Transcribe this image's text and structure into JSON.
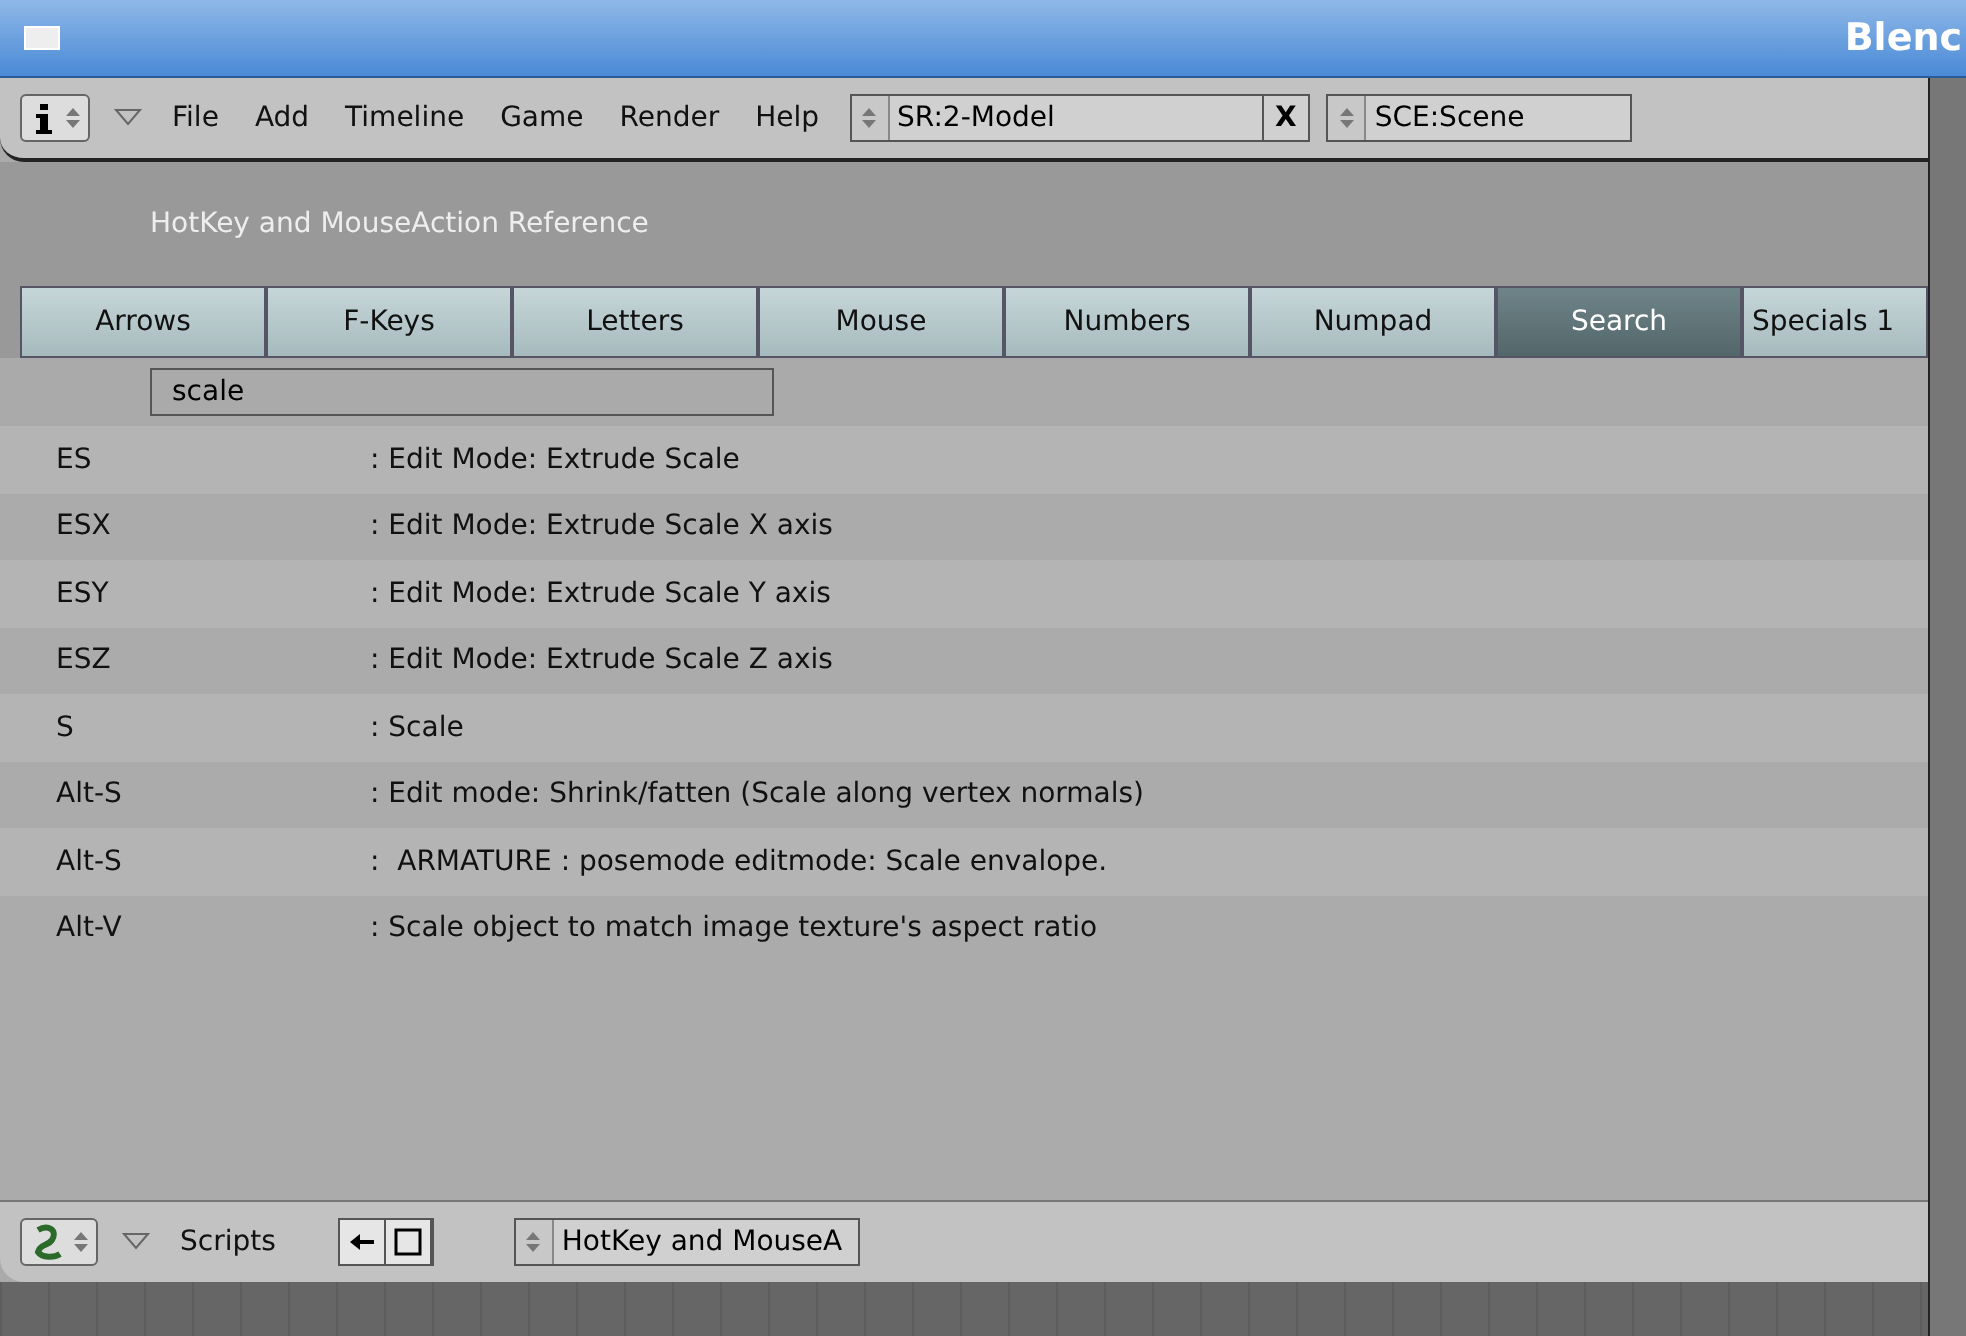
{
  "window": {
    "title": "Blenc"
  },
  "header": {
    "menus": [
      "File",
      "Add",
      "Timeline",
      "Game",
      "Render",
      "Help"
    ],
    "screen": "SR:2-Model",
    "delete": "X",
    "scene": "SCE:Scene"
  },
  "panel": {
    "title": "HotKey and MouseAction Reference"
  },
  "tabs": [
    {
      "label": "Arrows",
      "selected": false
    },
    {
      "label": "F-Keys",
      "selected": false
    },
    {
      "label": "Letters",
      "selected": false
    },
    {
      "label": "Mouse",
      "selected": false
    },
    {
      "label": "Numbers",
      "selected": false
    },
    {
      "label": "Numpad",
      "selected": false
    },
    {
      "label": "Search",
      "selected": true
    },
    {
      "label": "Specials 1",
      "selected": false
    }
  ],
  "search": {
    "value": "scale"
  },
  "results": [
    {
      "key": "ES",
      "action": ": Edit Mode: Extrude Scale"
    },
    {
      "key": "ESX",
      "action": ": Edit Mode: Extrude Scale X axis"
    },
    {
      "key": "ESY",
      "action": ": Edit Mode: Extrude Scale Y axis"
    },
    {
      "key": "ESZ",
      "action": ": Edit Mode: Extrude Scale Z axis"
    },
    {
      "key": "S",
      "action": ": Scale"
    },
    {
      "key": "Alt-S",
      "action": ": Edit mode: Shrink/fatten (Scale along vertex normals)"
    },
    {
      "key": "Alt-S",
      "action": ":  ARMATURE : posemode editmode: Scale envalope."
    },
    {
      "key": "Alt-V",
      "action": ": Scale object to match image texture's aspect ratio"
    }
  ],
  "footer": {
    "menu": "Scripts",
    "script": "HotKey and MouseA"
  }
}
